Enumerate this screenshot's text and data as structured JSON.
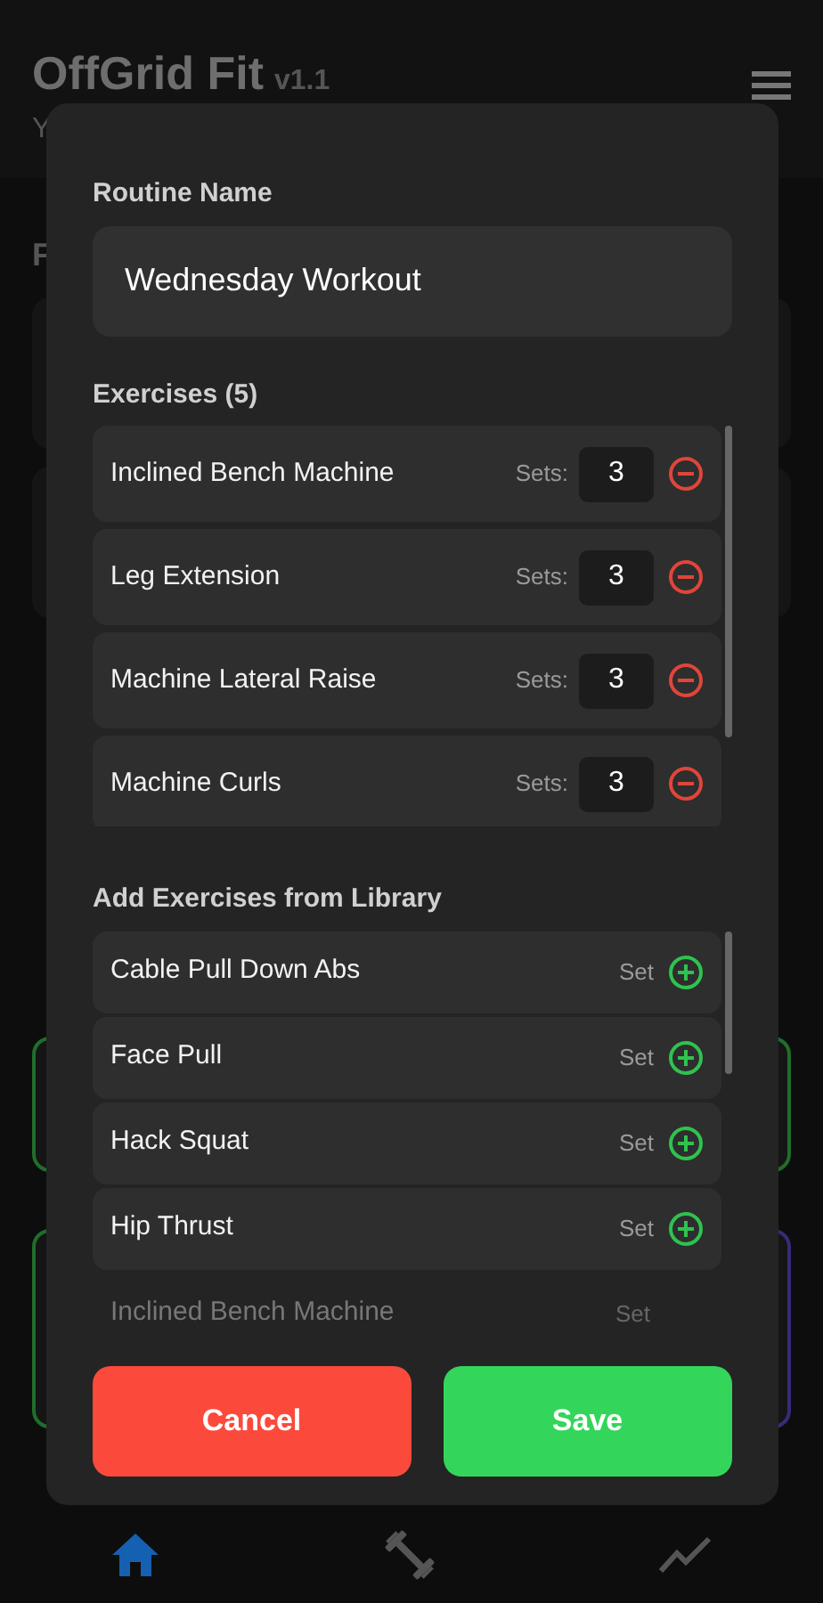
{
  "app": {
    "title": "OffGrid Fit",
    "version": "v1.1",
    "subtitle": "Y",
    "section_heading": "F"
  },
  "dialog": {
    "routine_name": {
      "label": "Routine Name",
      "value": "Wednesday Workout"
    },
    "exercises": {
      "heading": "Exercises (5)",
      "items": [
        {
          "name": "Inclined Bench Machine",
          "sets_label": "Sets:",
          "sets": "3"
        },
        {
          "name": "Leg Extension",
          "sets_label": "Sets:",
          "sets": "3"
        },
        {
          "name": "Machine Lateral Raise",
          "sets_label": "Sets:",
          "sets": "3"
        },
        {
          "name": "Machine Curls",
          "sets_label": "Sets:",
          "sets": "3"
        }
      ]
    },
    "library": {
      "heading": "Add Exercises from Library",
      "items": [
        {
          "name": "Cable Pull Down Abs",
          "action": "Set",
          "faded": false
        },
        {
          "name": "Face Pull",
          "action": "Set",
          "faded": false
        },
        {
          "name": "Hack Squat",
          "action": "Set",
          "faded": false
        },
        {
          "name": "Hip Thrust",
          "action": "Set",
          "faded": false
        },
        {
          "name": "Inclined Bench Machine",
          "action": "Set",
          "faded": true
        }
      ]
    },
    "buttons": [
      {
        "label": "Cancel",
        "kind": "cancel"
      },
      {
        "label": "Save",
        "kind": "save"
      }
    ]
  },
  "bottom_nav": [
    {
      "kind": "home",
      "selected": true
    },
    {
      "kind": "workouts",
      "selected": false
    },
    {
      "kind": "progress",
      "selected": false
    }
  ]
}
